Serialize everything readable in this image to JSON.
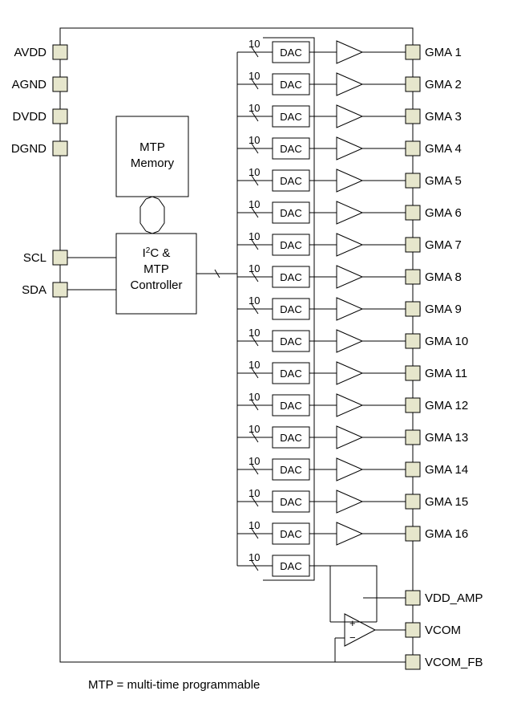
{
  "pins_left": [
    {
      "name": "avdd",
      "label": "AVDD"
    },
    {
      "name": "agnd",
      "label": "AGND"
    },
    {
      "name": "dvdd",
      "label": "DVDD"
    },
    {
      "name": "dgnd",
      "label": "DGND"
    },
    {
      "name": "scl",
      "label": "SCL"
    },
    {
      "name": "sda",
      "label": "SDA"
    }
  ],
  "pins_right_gma": [
    {
      "name": "gma1",
      "label": "GMA 1"
    },
    {
      "name": "gma2",
      "label": "GMA 2"
    },
    {
      "name": "gma3",
      "label": "GMA 3"
    },
    {
      "name": "gma4",
      "label": "GMA 4"
    },
    {
      "name": "gma5",
      "label": "GMA 5"
    },
    {
      "name": "gma6",
      "label": "GMA 6"
    },
    {
      "name": "gma7",
      "label": "GMA 7"
    },
    {
      "name": "gma8",
      "label": "GMA 8"
    },
    {
      "name": "gma9",
      "label": "GMA 9"
    },
    {
      "name": "gma10",
      "label": "GMA 10"
    },
    {
      "name": "gma11",
      "label": "GMA 11"
    },
    {
      "name": "gma12",
      "label": "GMA 12"
    },
    {
      "name": "gma13",
      "label": "GMA 13"
    },
    {
      "name": "gma14",
      "label": "GMA 14"
    },
    {
      "name": "gma15",
      "label": "GMA 15"
    },
    {
      "name": "gma16",
      "label": "GMA 16"
    }
  ],
  "pins_right_extra": [
    {
      "name": "vdd_amp",
      "label": "VDD_AMP"
    },
    {
      "name": "vcom",
      "label": "VCOM"
    },
    {
      "name": "vcom_fb",
      "label": "VCOM_FB"
    }
  ],
  "blocks": {
    "mtp_memory": [
      "MTP",
      "Memory"
    ],
    "controller": [
      "I",
      "2",
      "C & ",
      "MTP",
      "Controller"
    ],
    "dac_label": "DAC",
    "bus_width": "10"
  },
  "footnote": "MTP = multi-time programmable",
  "dac_count": 17
}
